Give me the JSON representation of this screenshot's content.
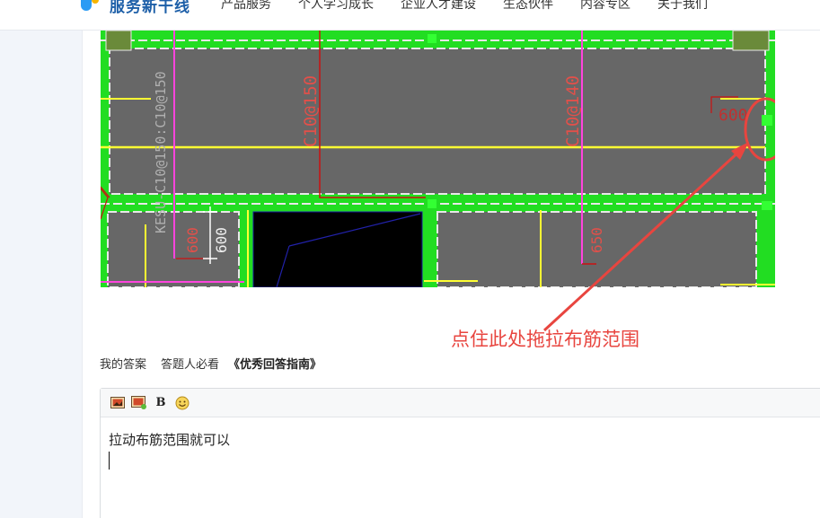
{
  "header": {
    "logo_text": "服务新干线",
    "nav": [
      "产品服务",
      "个人学习成长",
      "企业人才建设",
      "生态伙伴",
      "内容专区",
      "关于我们"
    ]
  },
  "cad_labels": {
    "vertical_rebar": "KESU-C10@150:C10@150",
    "rebar_mid1": "C10@150",
    "rebar_mid2": "C10@140",
    "dim_600_a": "600",
    "dim_600_b": "600",
    "dim_600_right": "600",
    "dim_650": "650"
  },
  "annotation": "点住此处拖拉布筋范围",
  "answer": {
    "my_answer": "我的答案",
    "must_read": "答题人必看",
    "guide": "《优秀回答指南》"
  },
  "editor": {
    "content": "拉动布筋范围就可以"
  },
  "colors": {
    "annotation": "#e8453f",
    "cad_green": "#22dd22",
    "cad_gray": "#676767",
    "cad_yellow": "#ffff33",
    "cad_magenta": "#ff44dd"
  }
}
